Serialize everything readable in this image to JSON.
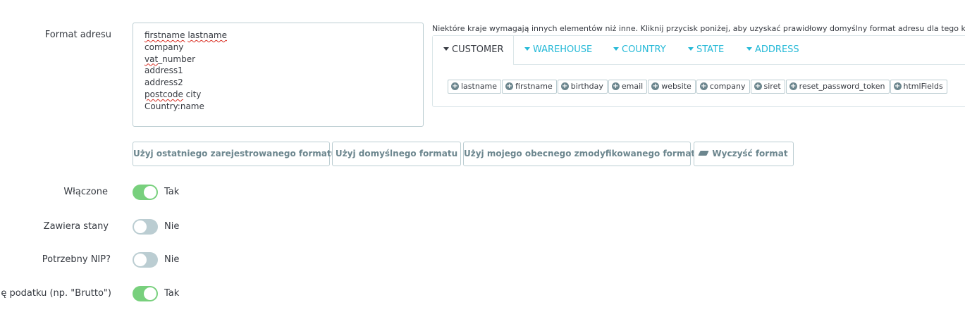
{
  "format": {
    "label": "Format adresu",
    "lines": [
      {
        "parts": [
          {
            "t": "firstname",
            "sq": true
          },
          {
            "t": " "
          },
          {
            "t": "lastname",
            "sq": true
          }
        ]
      },
      {
        "parts": [
          {
            "t": "company"
          }
        ]
      },
      {
        "parts": [
          {
            "t": "vat",
            "sq": true
          },
          {
            "t": "_number"
          }
        ]
      },
      {
        "parts": [
          {
            "t": "address1"
          }
        ]
      },
      {
        "parts": [
          {
            "t": "address2"
          }
        ]
      },
      {
        "parts": [
          {
            "t": "postcode",
            "sq": true
          },
          {
            "t": " city"
          }
        ]
      },
      {
        "parts": [
          {
            "t": "Country:name"
          }
        ]
      }
    ]
  },
  "help_text": "Niektóre kraje wymagają innych elementów niż inne. Kliknij przycisk poniżej, aby uzyskać prawidłowy domyślny format adresu dla tego k",
  "tabs": [
    {
      "label": "CUSTOMER",
      "active": true
    },
    {
      "label": "WAREHOUSE"
    },
    {
      "label": "COUNTRY"
    },
    {
      "label": "STATE"
    },
    {
      "label": "ADDRESS"
    }
  ],
  "fields": [
    "lastname",
    "firstname",
    "birthday",
    "email",
    "website",
    "company",
    "siret",
    "reset_password_token",
    "htmlFields"
  ],
  "buttons": {
    "last_registered": "Użyj ostatniego zarejestrowanego formatu",
    "default": "Użyj domyślnego formatu",
    "current_modified": "Użyj mojego obecnego zmodyfikowanego formatu",
    "clear": "Wyczyść format"
  },
  "toggles": {
    "enabled": {
      "label": "Włączone",
      "value": "Tak",
      "on": true
    },
    "has_states": {
      "label": "Zawiera stany",
      "value": "Nie",
      "on": false
    },
    "need_nip": {
      "label": "Potrzebny NIP?",
      "value": "Nie",
      "on": false
    },
    "tax_label": {
      "label": "ę podatku (np. \"Brutto\")",
      "value": "Tak",
      "on": true
    }
  },
  "colors": {
    "accent": "#25b9d7",
    "switch_on": "#78d07d",
    "switch_off": "#bbcdd2"
  }
}
